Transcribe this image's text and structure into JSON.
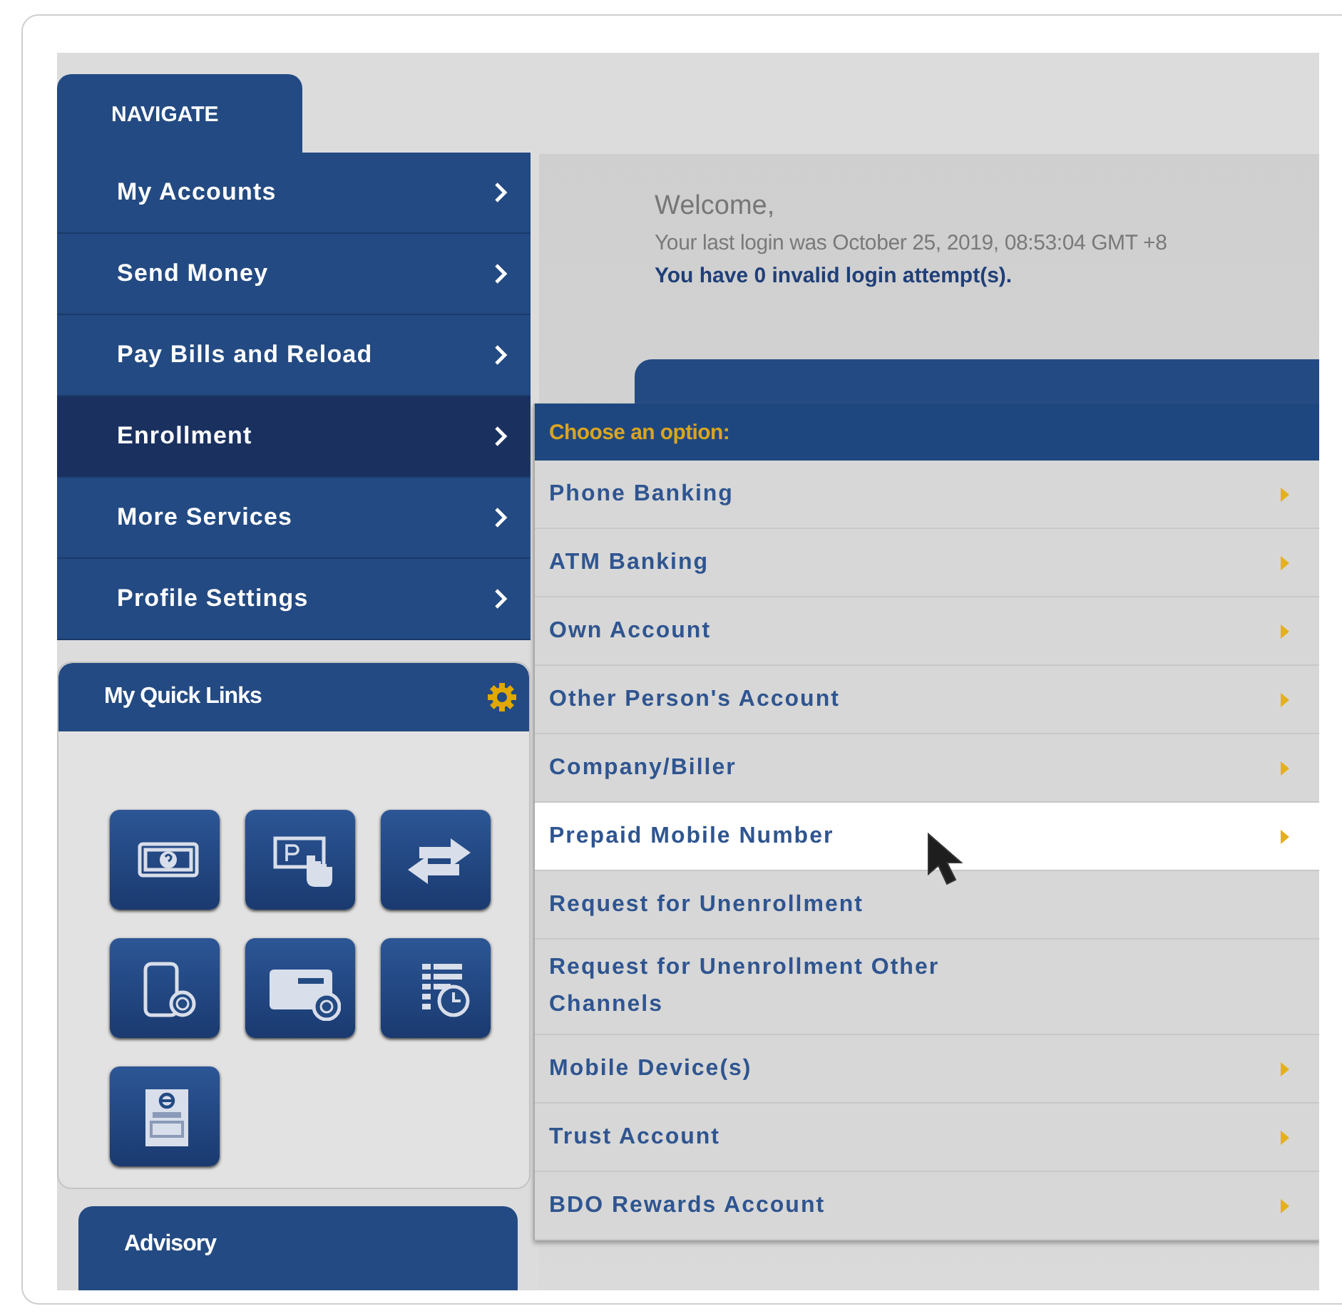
{
  "navigation": {
    "tab": "NAVIGATE",
    "items": [
      {
        "label": "My Accounts",
        "selected": false
      },
      {
        "label": "Send Money",
        "selected": false
      },
      {
        "label": "Pay Bills and Reload",
        "selected": false
      },
      {
        "label": "Enrollment",
        "selected": true
      },
      {
        "label": "More Services",
        "selected": false
      },
      {
        "label": "Profile Settings",
        "selected": false
      }
    ]
  },
  "quick_links": {
    "title": "My Quick Links",
    "items": [
      {
        "kind": "cash"
      },
      {
        "kind": "tap"
      },
      {
        "kind": "transfer"
      },
      {
        "kind": "phone"
      },
      {
        "kind": "card"
      },
      {
        "kind": "schedule"
      },
      {
        "kind": "statement"
      }
    ]
  },
  "advisory": {
    "title": "Advisory"
  },
  "welcome": {
    "greeting": "Welcome,",
    "last_login": "Your last login was October 25, 2019, 08:53:04 GMT +8",
    "attempts": "You have 0 invalid login attempt(s)."
  },
  "submenu": {
    "header": "Choose an option:",
    "items": [
      {
        "label": "Phone Banking",
        "has_arrow": true,
        "selected": false
      },
      {
        "label": "ATM Banking",
        "has_arrow": true,
        "selected": false
      },
      {
        "label": "Own Account",
        "has_arrow": true,
        "selected": false
      },
      {
        "label": "Other Person's Account",
        "has_arrow": true,
        "selected": false
      },
      {
        "label": "Company/Biller",
        "has_arrow": true,
        "selected": false
      },
      {
        "label": "Prepaid Mobile Number",
        "has_arrow": true,
        "selected": true
      },
      {
        "label": "Request for Unenrollment",
        "has_arrow": false,
        "selected": false
      },
      {
        "label": "Request for Unenrollment Other Channels",
        "has_arrow": false,
        "selected": false
      },
      {
        "label": "Mobile Device(s)",
        "has_arrow": true,
        "selected": false
      },
      {
        "label": "Trust Account",
        "has_arrow": true,
        "selected": false
      },
      {
        "label": "BDO Rewards Account",
        "has_arrow": true,
        "selected": false
      }
    ]
  }
}
